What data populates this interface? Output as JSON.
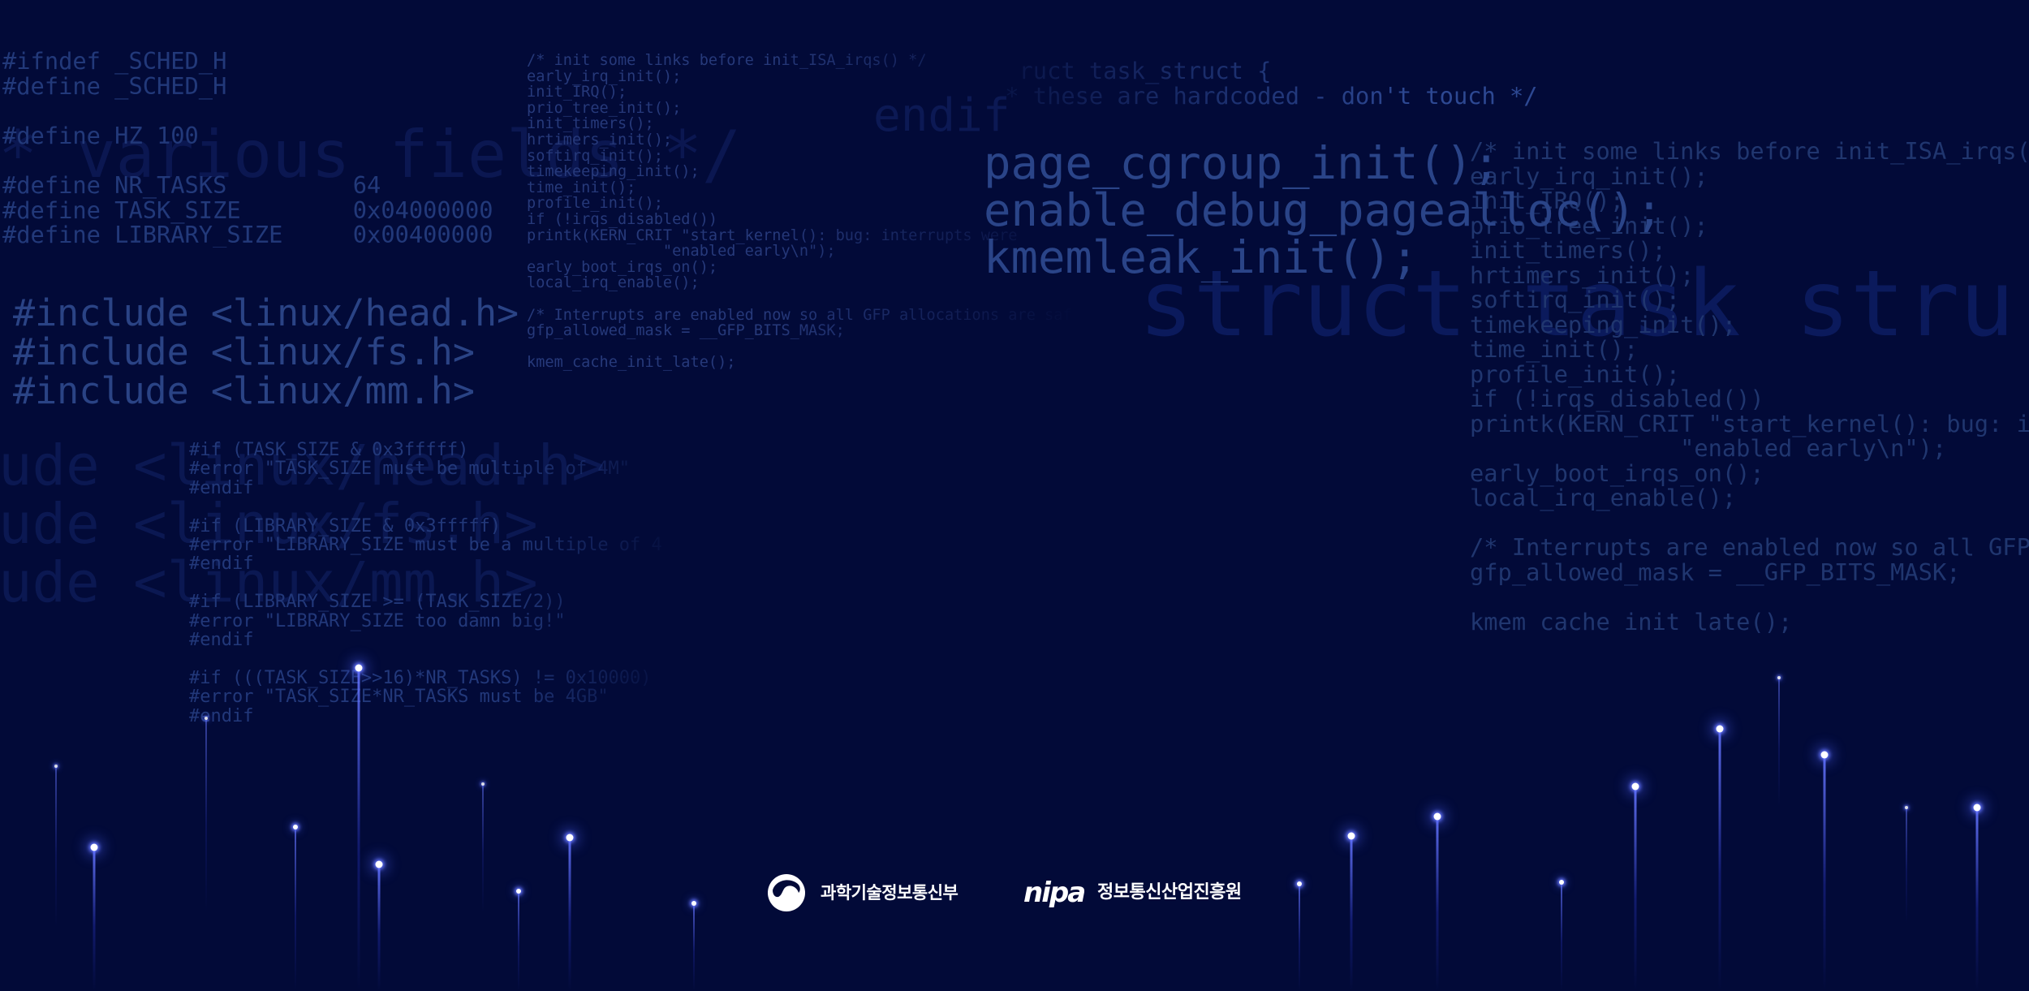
{
  "theme": {
    "background": "#020a38",
    "glow": "#6676ff"
  },
  "code": {
    "sched_header": [
      "#ifndef _SCHED_H",
      "#define _SCHED_H",
      "",
      "#define HZ 100",
      "",
      "#define NR_TASKS         64",
      "#define TASK_SIZE        0x04000000",
      "#define LIBRARY_SIZE     0x00400000"
    ],
    "init_small": [
      "/* init some links before init_ISA_irqs() */",
      "early_irq_init();",
      "init_IRQ();",
      "prio_tree_init();",
      "init_timers();",
      "hrtimers_init();",
      "softirq_init();",
      "timekeeping_init();",
      "time_init();",
      "profile_init();",
      "if (!irqs_disabled())",
      "printk(KERN_CRIT \"start_kernel(): bug: interrupts were",
      "               \"enabled early\\n\");",
      "early_boot_irqs_on();",
      "local_irq_enable();",
      "",
      "/* Interrupts are enabled now so all GFP allocations are saf",
      "gfp_allowed_mask = __GFP_BITS_MASK;",
      "",
      "kmem_cache_init_late();"
    ],
    "includes": [
      "#include <linux/head.h>",
      "#include <linux/fs.h>",
      "#include <linux/mm.h>"
    ],
    "size_checks": [
      "#if (TASK_SIZE & 0x3fffff)",
      "#error \"TASK_SIZE must be multiple of 4M\"",
      "#endif",
      "",
      "#if (LIBRARY_SIZE & 0x3fffff)",
      "#error \"LIBRARY_SIZE must be a multiple of 4",
      "#endif",
      "",
      "#if (LIBRARY_SIZE >= (TASK_SIZE/2))",
      "#error \"LIBRARY_SIZE too damn big!\"",
      "#endif",
      "",
      "#if (((TASK_SIZE>>16)*NR_TASKS) != 0x10000)",
      "#error \"TASK_SIZE*NR_TASKS must be 4GB\"",
      "#endif"
    ],
    "task_struct": [
      "ruct task_struct {",
      "* these are hardcoded - don't touch */"
    ],
    "debug_init": [
      "page_cgroup_init();",
      "enable_debug_pagealloc();",
      "kmemleak_init();"
    ],
    "init_large": [
      "/* init some links before init_ISA_irqs(",
      "early_irq_init();",
      "init_IRQ();",
      "prio_tree_init();",
      "init_timers();",
      "hrtimers_init();",
      "softirq_init();",
      "timekeeping_init();",
      "time_init();",
      "profile_init();",
      "if (!irqs_disabled())",
      "printk(KERN_CRIT \"start_kernel(): bug: i",
      "               \"enabled early\\n\");",
      "early_boot_irqs_on();",
      "local_irq_enable();",
      "",
      "/* Interrupts are enabled now so all GFP",
      "gfp_allowed_mask = __GFP_BITS_MASK;",
      "",
      "kmem_cache_init_late();"
    ]
  },
  "background_text": {
    "various_fields": "* various fields */",
    "endif": "endif",
    "include_fragments": [
      "ude <linux/head.h>",
      "ude <linux/fs.h>",
      "ude <linux/mm.h>"
    ],
    "task_struct": "struct task_stru"
  },
  "logos": {
    "ministry_icon": "government-emblem-icon",
    "ministry_name": "과학기술정보통신부",
    "agency_wordmark": "nipa",
    "agency_name": "정보통신산업진흥원"
  }
}
